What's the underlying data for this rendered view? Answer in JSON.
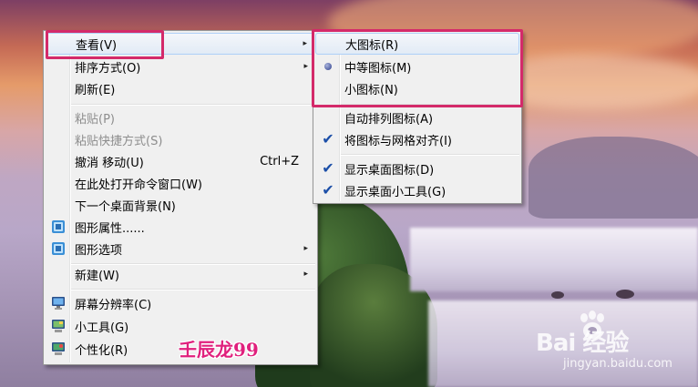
{
  "main_menu": {
    "items": [
      {
        "label": "查看(V)",
        "arrow": "▸"
      },
      {
        "label": "排序方式(O)",
        "arrow": "▸"
      },
      {
        "label": "刷新(E)"
      },
      {
        "label": "粘贴(P)"
      },
      {
        "label": "粘贴快捷方式(S)"
      },
      {
        "label": "撤消 移动(U)",
        "shortcut": "Ctrl+Z"
      },
      {
        "label": "在此处打开命令窗口(W)"
      },
      {
        "label": "下一个桌面背景(N)"
      },
      {
        "label": "图形属性......",
        "icon": "graphics-properties-icon"
      },
      {
        "label": "图形选项",
        "icon": "graphics-options-icon",
        "arrow": "▸"
      },
      {
        "label": "新建(W)",
        "arrow": "▸"
      },
      {
        "label": "屏幕分辨率(C)",
        "icon": "monitor-icon"
      },
      {
        "label": "小工具(G)",
        "icon": "gadgets-icon"
      },
      {
        "label": "个性化(R)",
        "icon": "personalize-icon"
      }
    ]
  },
  "view_submenu": {
    "items": [
      {
        "label": "大图标(R)"
      },
      {
        "label": "中等图标(M)",
        "mark": "radio"
      },
      {
        "label": "小图标(N)"
      },
      {
        "label": "自动排列图标(A)"
      },
      {
        "label": "将图标与网格对齐(I)",
        "mark": "check",
        "mark_glyph": "✔"
      },
      {
        "label": "显示桌面图标(D)",
        "mark": "check",
        "mark_glyph": "✔"
      },
      {
        "label": "显示桌面小工具(G)",
        "mark": "check",
        "mark_glyph": "✔"
      }
    ]
  },
  "watermarks": {
    "author": "壬辰龙99",
    "brand": "Bai  经验",
    "url": "jingyan.baidu.com"
  },
  "colors": {
    "highlight_box": "#d42a6a",
    "check": "#1c4fa8",
    "author_text": "#e0207d"
  }
}
